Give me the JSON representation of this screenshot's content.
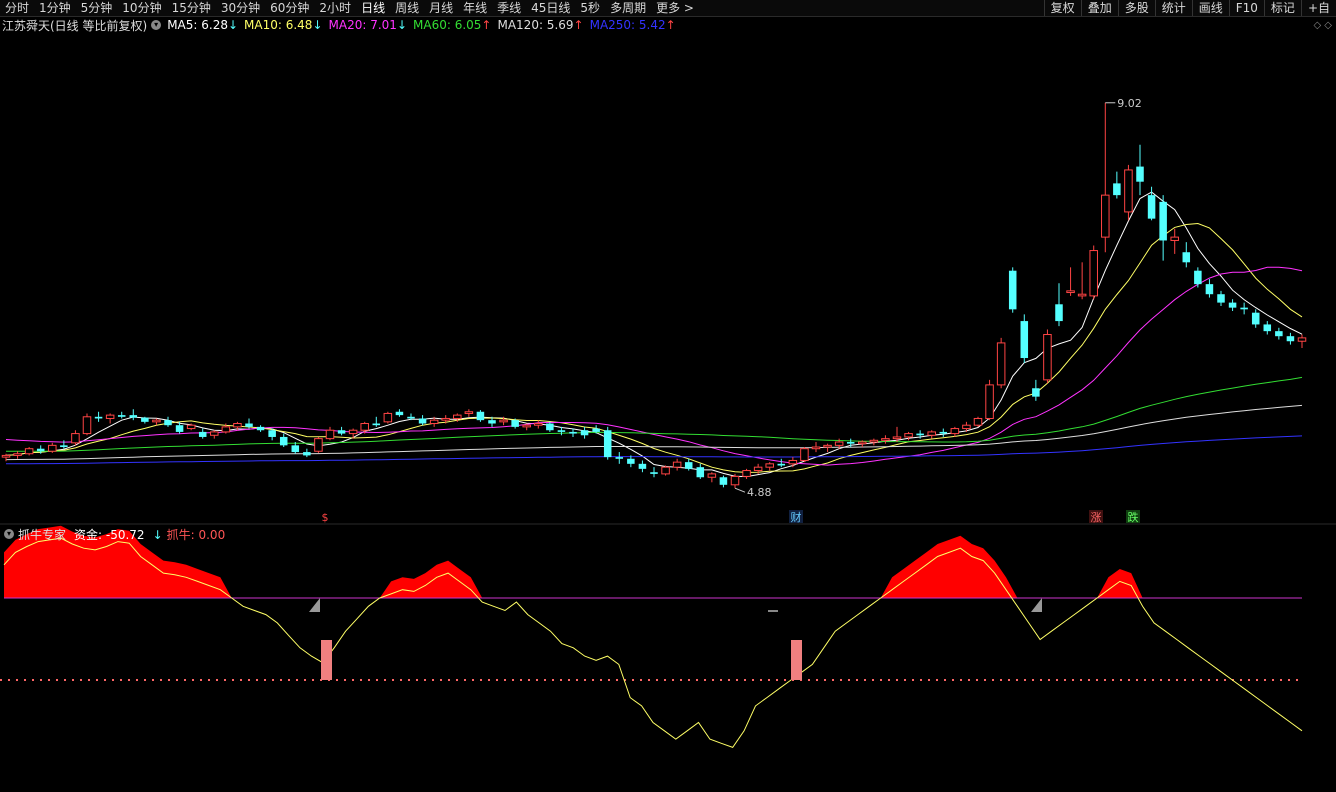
{
  "toolbar": {
    "periods": [
      "分时",
      "1分钟",
      "5分钟",
      "10分钟",
      "15分钟",
      "30分钟",
      "60分钟",
      "2小时",
      "日线",
      "周线",
      "月线",
      "年线",
      "季线",
      "45日线",
      "5秒",
      "多周期",
      "更多 >"
    ],
    "active": "日线",
    "right_buttons": [
      "复权",
      "叠加",
      "多股",
      "统计",
      "画线",
      "F10",
      "标记",
      "+自"
    ]
  },
  "main_info": {
    "title": "江苏舜天(日线 等比前复权)",
    "ma": [
      {
        "label": "MA5: 6.28",
        "arrow": "↓",
        "color": "#ffffff"
      },
      {
        "label": "MA10: 6.48",
        "arrow": "↓",
        "color": "#ffff66"
      },
      {
        "label": "MA20: 7.01",
        "arrow": "↓",
        "color": "#ff33ff"
      },
      {
        "label": "MA60: 6.05",
        "arrow": "↑",
        "color": "#33dd33"
      },
      {
        "label": "MA120: 5.69",
        "arrow": "↑",
        "color": "#dddddd"
      },
      {
        "label": "MA250: 5.42",
        "arrow": "↑",
        "color": "#3333ff"
      }
    ]
  },
  "chart_labels": {
    "high": "9.02",
    "low": "4.88",
    "marker_dollar": "$",
    "marker_cai": "财",
    "marker_zhang": "涨",
    "marker_die": "跌"
  },
  "indicator_info": {
    "title": "抓牛专家",
    "fund": "资金: -50.72",
    "fund_arrow": "↓",
    "bull": "抓牛: 0.00"
  },
  "colors": {
    "up": "#ff4444",
    "down": "#54ffff",
    "fund_area": "#ff0000",
    "fund_line": "#ffff66",
    "zero_line": "#cc33cc",
    "dotted": "#ff6666"
  },
  "chart_data": {
    "type": "candlestick",
    "title": "江苏舜天(日线 等比前复权)",
    "price_high": 9.02,
    "price_low": 4.88,
    "candles": [
      [
        4.38,
        4.42,
        4.33,
        4.4
      ],
      [
        4.4,
        4.45,
        4.36,
        4.42
      ],
      [
        4.42,
        4.5,
        4.4,
        4.48
      ],
      [
        4.48,
        4.52,
        4.42,
        4.45
      ],
      [
        4.45,
        4.55,
        4.43,
        4.52
      ],
      [
        4.52,
        4.58,
        4.48,
        4.5
      ],
      [
        4.55,
        4.7,
        4.52,
        4.66
      ],
      [
        4.66,
        4.9,
        4.64,
        4.86
      ],
      [
        4.86,
        4.92,
        4.8,
        4.84
      ],
      [
        4.84,
        4.9,
        4.78,
        4.88
      ],
      [
        4.88,
        4.92,
        4.84,
        4.86
      ],
      [
        4.88,
        4.95,
        4.82,
        4.85
      ],
      [
        4.85,
        4.86,
        4.78,
        4.8
      ],
      [
        4.8,
        4.84,
        4.76,
        4.82
      ],
      [
        4.82,
        4.86,
        4.74,
        4.76
      ],
      [
        4.76,
        4.8,
        4.66,
        4.68
      ],
      [
        4.72,
        4.78,
        4.7,
        4.76
      ],
      [
        4.68,
        4.72,
        4.6,
        4.62
      ],
      [
        4.64,
        4.7,
        4.6,
        4.68
      ],
      [
        4.68,
        4.78,
        4.66,
        4.74
      ],
      [
        4.74,
        4.8,
        4.7,
        4.78
      ],
      [
        4.78,
        4.84,
        4.72,
        4.74
      ],
      [
        4.74,
        4.76,
        4.68,
        4.7
      ],
      [
        4.7,
        4.72,
        4.58,
        4.62
      ],
      [
        4.62,
        4.66,
        4.5,
        4.52
      ],
      [
        4.52,
        4.56,
        4.42,
        4.44
      ],
      [
        4.44,
        4.48,
        4.38,
        4.4
      ],
      [
        4.45,
        4.62,
        4.43,
        4.6
      ],
      [
        4.6,
        4.74,
        4.58,
        4.7
      ],
      [
        4.7,
        4.74,
        4.64,
        4.66
      ],
      [
        4.66,
        4.72,
        4.6,
        4.7
      ],
      [
        4.7,
        4.8,
        4.66,
        4.78
      ],
      [
        4.78,
        4.86,
        4.74,
        4.76
      ],
      [
        4.8,
        4.92,
        4.78,
        4.9
      ],
      [
        4.92,
        4.95,
        4.86,
        4.88
      ],
      [
        4.86,
        4.9,
        4.82,
        4.84
      ],
      [
        4.84,
        4.88,
        4.76,
        4.78
      ],
      [
        4.78,
        4.86,
        4.74,
        4.82
      ],
      [
        4.82,
        4.88,
        4.78,
        4.84
      ],
      [
        4.84,
        4.9,
        4.8,
        4.88
      ],
      [
        4.9,
        4.95,
        4.86,
        4.92
      ],
      [
        4.92,
        4.94,
        4.8,
        4.82
      ],
      [
        4.82,
        4.86,
        4.74,
        4.78
      ],
      [
        4.8,
        4.86,
        4.76,
        4.82
      ],
      [
        4.82,
        4.84,
        4.72,
        4.74
      ],
      [
        4.74,
        4.78,
        4.7,
        4.76
      ],
      [
        4.76,
        4.82,
        4.72,
        4.78
      ],
      [
        4.78,
        4.8,
        4.68,
        4.7
      ],
      [
        4.7,
        4.74,
        4.64,
        4.68
      ],
      [
        4.68,
        4.72,
        4.62,
        4.66
      ],
      [
        4.7,
        4.74,
        4.6,
        4.64
      ],
      [
        4.72,
        4.76,
        4.66,
        4.68
      ],
      [
        4.7,
        4.74,
        4.35,
        4.38
      ],
      [
        4.38,
        4.44,
        4.3,
        4.36
      ],
      [
        4.36,
        4.4,
        4.26,
        4.3
      ],
      [
        4.3,
        4.34,
        4.2,
        4.24
      ],
      [
        4.2,
        4.26,
        4.14,
        4.18
      ],
      [
        4.18,
        4.28,
        4.16,
        4.26
      ],
      [
        4.26,
        4.36,
        4.22,
        4.32
      ],
      [
        4.32,
        4.36,
        4.22,
        4.24
      ],
      [
        4.26,
        4.3,
        4.12,
        4.14
      ],
      [
        4.14,
        4.2,
        4.08,
        4.18
      ],
      [
        4.14,
        4.16,
        4.02,
        4.05
      ],
      [
        4.05,
        4.18,
        4.01,
        4.15
      ],
      [
        4.15,
        4.24,
        4.12,
        4.22
      ],
      [
        4.22,
        4.3,
        4.18,
        4.26
      ],
      [
        4.26,
        4.32,
        4.22,
        4.3
      ],
      [
        4.3,
        4.36,
        4.26,
        4.28
      ],
      [
        4.3,
        4.38,
        4.26,
        4.34
      ],
      [
        4.34,
        4.5,
        4.32,
        4.48
      ],
      [
        4.48,
        4.56,
        4.44,
        4.5
      ],
      [
        4.5,
        4.54,
        4.44,
        4.52
      ],
      [
        4.52,
        4.6,
        4.48,
        4.56
      ],
      [
        4.56,
        4.6,
        4.5,
        4.54
      ],
      [
        4.54,
        4.58,
        4.5,
        4.56
      ],
      [
        4.56,
        4.6,
        4.52,
        4.58
      ],
      [
        4.58,
        4.64,
        4.54,
        4.6
      ],
      [
        4.6,
        4.74,
        4.56,
        4.62
      ],
      [
        4.62,
        4.68,
        4.58,
        4.66
      ],
      [
        4.66,
        4.7,
        4.6,
        4.64
      ],
      [
        4.64,
        4.7,
        4.6,
        4.68
      ],
      [
        4.68,
        4.72,
        4.62,
        4.66
      ],
      [
        4.66,
        4.74,
        4.62,
        4.72
      ],
      [
        4.72,
        4.8,
        4.68,
        4.76
      ],
      [
        4.76,
        4.86,
        4.74,
        4.84
      ],
      [
        4.84,
        5.3,
        4.82,
        5.24
      ],
      [
        5.24,
        5.8,
        5.2,
        5.74
      ],
      [
        6.6,
        6.64,
        6.1,
        6.14
      ],
      [
        6.0,
        6.08,
        5.5,
        5.56
      ],
      [
        5.2,
        5.3,
        5.05,
        5.1
      ],
      [
        5.3,
        5.9,
        5.26,
        5.84
      ],
      [
        6.2,
        6.45,
        5.94,
        6.0
      ],
      [
        6.34,
        6.64,
        6.3,
        6.36
      ],
      [
        6.3,
        6.7,
        6.26,
        6.32
      ],
      [
        6.3,
        6.9,
        6.26,
        6.84
      ],
      [
        7.0,
        8.6,
        6.82,
        7.5
      ],
      [
        7.64,
        7.78,
        7.46,
        7.5
      ],
      [
        7.3,
        7.86,
        7.2,
        7.8
      ],
      [
        7.84,
        8.1,
        7.5,
        7.66
      ],
      [
        7.5,
        7.6,
        7.2,
        7.22
      ],
      [
        7.42,
        7.5,
        6.72,
        6.96
      ],
      [
        6.96,
        7.1,
        6.8,
        7.0
      ],
      [
        6.82,
        6.94,
        6.64,
        6.7
      ],
      [
        6.6,
        6.64,
        6.4,
        6.44
      ],
      [
        6.44,
        6.5,
        6.28,
        6.32
      ],
      [
        6.32,
        6.36,
        6.18,
        6.22
      ],
      [
        6.22,
        6.26,
        6.12,
        6.16
      ],
      [
        6.16,
        6.22,
        6.08,
        6.14
      ],
      [
        6.1,
        6.14,
        5.92,
        5.96
      ],
      [
        5.96,
        6.0,
        5.84,
        5.88
      ],
      [
        5.88,
        5.92,
        5.78,
        5.82
      ],
      [
        5.82,
        5.86,
        5.72,
        5.76
      ],
      [
        5.76,
        5.84,
        5.68,
        5.8
      ]
    ],
    "fund_series": [
      40,
      55,
      62,
      68,
      70,
      72,
      65,
      60,
      58,
      62,
      68,
      66,
      50,
      40,
      30,
      28,
      25,
      20,
      15,
      10,
      0,
      -10,
      -15,
      -20,
      -30,
      -45,
      -60,
      -70,
      -78,
      -60,
      -40,
      -25,
      -10,
      0,
      5,
      10,
      8,
      15,
      25,
      30,
      20,
      10,
      -5,
      -10,
      -15,
      -5,
      -20,
      -30,
      -40,
      -55,
      -60,
      -70,
      -75,
      -70,
      -80,
      -120,
      -130,
      -150,
      -160,
      -170,
      -160,
      -150,
      -170,
      -175,
      -180,
      -160,
      -130,
      -120,
      -110,
      -100,
      -90,
      -80,
      -60,
      -40,
      -30,
      -20,
      -10,
      0,
      10,
      20,
      30,
      40,
      50,
      55,
      60,
      50,
      45,
      30,
      10,
      -10,
      -30,
      -50,
      -40,
      -30,
      -20,
      -10,
      0,
      10,
      20,
      15,
      -10,
      -30,
      -40,
      -50,
      -60,
      -70,
      -80,
      -90,
      -100,
      -110,
      -120,
      -130,
      -140,
      -150,
      -160
    ]
  }
}
